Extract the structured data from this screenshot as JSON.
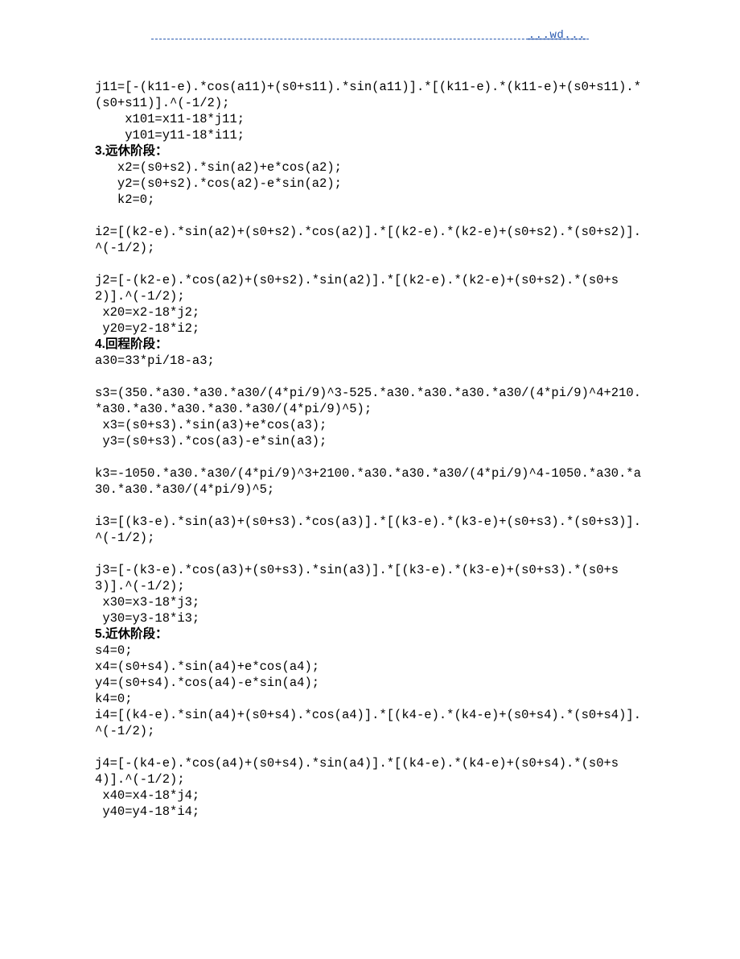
{
  "header": {
    "label": "...wd..."
  },
  "blocks": [
    {
      "type": "code",
      "text": "j11=[-(k11-e).*cos(a11)+(s0+s11).*sin(a11)].*[(k11-e).*(k11-e)+(s0+s11).*(s0+s11)].^(-1/2);"
    },
    {
      "type": "code",
      "text": "    x101=x11-18*j11;"
    },
    {
      "type": "code",
      "text": "    y101=y11-18*i11;"
    },
    {
      "type": "heading",
      "num": "3.",
      "text": "远休阶段："
    },
    {
      "type": "code",
      "text": "   x2=(s0+s2).*sin(a2)+e*cos(a2);"
    },
    {
      "type": "code",
      "text": "   y2=(s0+s2).*cos(a2)-e*sin(a2);"
    },
    {
      "type": "code",
      "text": "   k2=0;"
    },
    {
      "type": "blank"
    },
    {
      "type": "code",
      "text": "i2=[(k2-e).*sin(a2)+(s0+s2).*cos(a2)].*[(k2-e).*(k2-e)+(s0+s2).*(s0+s2)].^(-1/2);"
    },
    {
      "type": "blank"
    },
    {
      "type": "code",
      "text": "j2=[-(k2-e).*cos(a2)+(s0+s2).*sin(a2)].*[(k2-e).*(k2-e)+(s0+s2).*(s0+s2)].^(-1/2);"
    },
    {
      "type": "code",
      "text": " x20=x2-18*j2;"
    },
    {
      "type": "code",
      "text": " y20=y2-18*i2;"
    },
    {
      "type": "heading",
      "num": "4.",
      "text": "回程阶段："
    },
    {
      "type": "code",
      "text": "a30=33*pi/18-a3;"
    },
    {
      "type": "blank"
    },
    {
      "type": "code",
      "text": "s3=(350.*a30.*a30.*a30/(4*pi/9)^3-525.*a30.*a30.*a30.*a30/(4*pi/9)^4+210.*a30.*a30.*a30.*a30.*a30/(4*pi/9)^5);"
    },
    {
      "type": "code",
      "text": " x3=(s0+s3).*sin(a3)+e*cos(a3);"
    },
    {
      "type": "code",
      "text": " y3=(s0+s3).*cos(a3)-e*sin(a3);"
    },
    {
      "type": "blank"
    },
    {
      "type": "code",
      "text": "k3=-1050.*a30.*a30/(4*pi/9)^3+2100.*a30.*a30.*a30/(4*pi/9)^4-1050.*a30.*a30.*a30.*a30/(4*pi/9)^5;"
    },
    {
      "type": "blank"
    },
    {
      "type": "code",
      "text": "i3=[(k3-e).*sin(a3)+(s0+s3).*cos(a3)].*[(k3-e).*(k3-e)+(s0+s3).*(s0+s3)].^(-1/2);"
    },
    {
      "type": "blank"
    },
    {
      "type": "code",
      "text": "j3=[-(k3-e).*cos(a3)+(s0+s3).*sin(a3)].*[(k3-e).*(k3-e)+(s0+s3).*(s0+s3)].^(-1/2);"
    },
    {
      "type": "code",
      "text": " x30=x3-18*j3;"
    },
    {
      "type": "code",
      "text": " y30=y3-18*i3;"
    },
    {
      "type": "heading",
      "num": "5.",
      "text": "近休阶段："
    },
    {
      "type": "code",
      "text": "s4=0;"
    },
    {
      "type": "code",
      "text": "x4=(s0+s4).*sin(a4)+e*cos(a4);"
    },
    {
      "type": "code",
      "text": "y4=(s0+s4).*cos(a4)-e*sin(a4);"
    },
    {
      "type": "code",
      "text": "k4=0;"
    },
    {
      "type": "code",
      "text": "i4=[(k4-e).*sin(a4)+(s0+s4).*cos(a4)].*[(k4-e).*(k4-e)+(s0+s4).*(s0+s4)].^(-1/2);"
    },
    {
      "type": "blank"
    },
    {
      "type": "code",
      "text": "j4=[-(k4-e).*cos(a4)+(s0+s4).*sin(a4)].*[(k4-e).*(k4-e)+(s0+s4).*(s0+s4)].^(-1/2);"
    },
    {
      "type": "code",
      "text": " x40=x4-18*j4;"
    },
    {
      "type": "code",
      "text": " y40=y4-18*i4;"
    }
  ]
}
